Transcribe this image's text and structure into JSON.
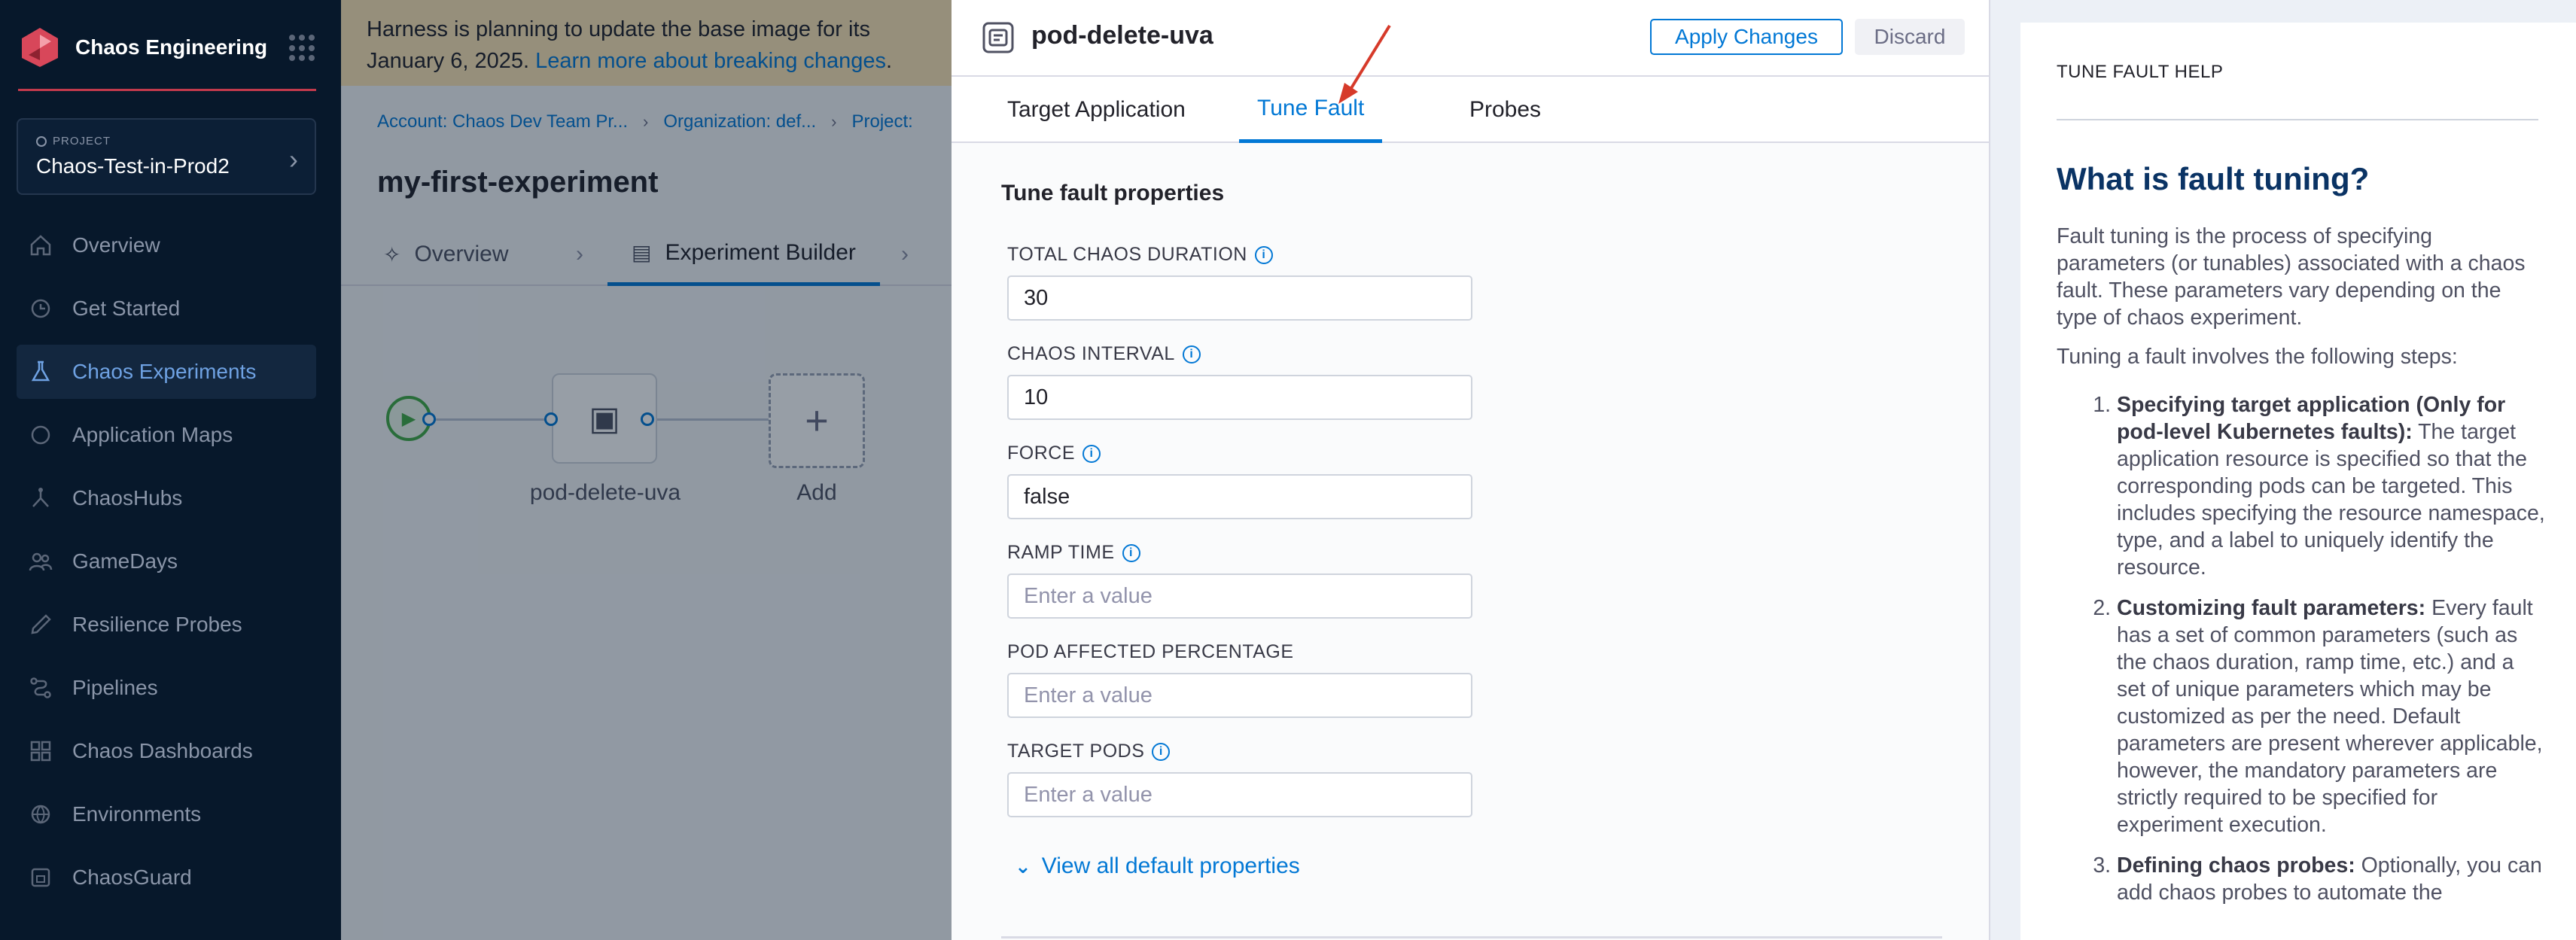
{
  "sidebar": {
    "brand": "Chaos Engineering",
    "project_kicker": "PROJECT",
    "project_name": "Chaos-Test-in-Prod2",
    "items": [
      {
        "label": "Overview",
        "icon": "home-icon"
      },
      {
        "label": "Get Started",
        "icon": "get-started-icon"
      },
      {
        "label": "Chaos Experiments",
        "icon": "flask-icon"
      },
      {
        "label": "Application Maps",
        "icon": "map-icon"
      },
      {
        "label": "ChaosHubs",
        "icon": "hub-icon"
      },
      {
        "label": "GameDays",
        "icon": "gamedays-icon"
      },
      {
        "label": "Resilience Probes",
        "icon": "probe-icon"
      },
      {
        "label": "Pipelines",
        "icon": "pipeline-icon"
      },
      {
        "label": "Chaos Dashboards",
        "icon": "dashboard-icon"
      },
      {
        "label": "Environments",
        "icon": "environment-icon"
      },
      {
        "label": "ChaosGuard",
        "icon": "guard-icon"
      }
    ],
    "active_index": 2
  },
  "banner": {
    "text": "Harness is planning to update the base image for its",
    "text2": "January 6, 2025.",
    "link": "Learn more about breaking changes",
    "end": "."
  },
  "breadcrumb": [
    "Account: Chaos Dev Team Pr...",
    "Organization: def...",
    "Project:"
  ],
  "experiment": {
    "title": "my-first-experiment",
    "tabs": [
      "Overview",
      "Experiment Builder"
    ],
    "node_label": "pod-delete-uva",
    "add_label": "Add"
  },
  "drawer": {
    "title": "pod-delete-uva",
    "apply_label": "Apply Changes",
    "discard_label": "Discard",
    "tabs": [
      "Target Application",
      "Tune Fault",
      "Probes"
    ],
    "active_tab": 1,
    "section_title": "Tune fault properties",
    "fields": [
      {
        "label": "TOTAL CHAOS DURATION",
        "value": "30",
        "placeholder": "Enter a value",
        "info": true
      },
      {
        "label": "CHAOS INTERVAL",
        "value": "10",
        "placeholder": "Enter a value",
        "info": true
      },
      {
        "label": "FORCE",
        "value": "false",
        "placeholder": "Enter a value",
        "info": true
      },
      {
        "label": "RAMP TIME",
        "value": "",
        "placeholder": "Enter a value",
        "info": true
      },
      {
        "label": "POD AFFECTED PERCENTAGE",
        "value": "",
        "placeholder": "Enter a value",
        "info": false
      },
      {
        "label": "TARGET PODS",
        "value": "",
        "placeholder": "Enter a value",
        "info": true
      }
    ],
    "view_all_label": "View all default properties"
  },
  "help": {
    "kicker": "TUNE FAULT HELP",
    "title": "What is fault tuning?",
    "intro": "Fault tuning is the process of specifying parameters (or tunables) associated with a chaos fault. These parameters vary depending on the type of chaos experiment.",
    "steps_intro": "Tuning a fault involves the following steps:",
    "steps": [
      {
        "bold": "Specifying target application (Only for pod-level Kubernetes faults):",
        "text": " The target application resource is specified so that the corresponding pods can be targeted. This includes specifying the resource namespace, type, and a label to uniquely identify the resource."
      },
      {
        "bold": "Customizing fault parameters:",
        "text": " Every fault has a set of common parameters (such as the chaos duration, ramp time, etc.) and a set of unique parameters which may be customized as per the need. Default parameters are present wherever applicable, however, the mandatory parameters are strictly required to be specified for experiment execution."
      },
      {
        "bold": "Defining chaos probes:",
        "text": " Optionally, you can add chaos probes to automate the"
      }
    ]
  },
  "colors": {
    "accent": "#0278d5",
    "sidebar_bg": "#07182b",
    "brand_red": "#c23a4c",
    "banner_bg": "#fde5b5",
    "help_title": "#0a3364",
    "annotation_arrow": "#d63a2a"
  }
}
